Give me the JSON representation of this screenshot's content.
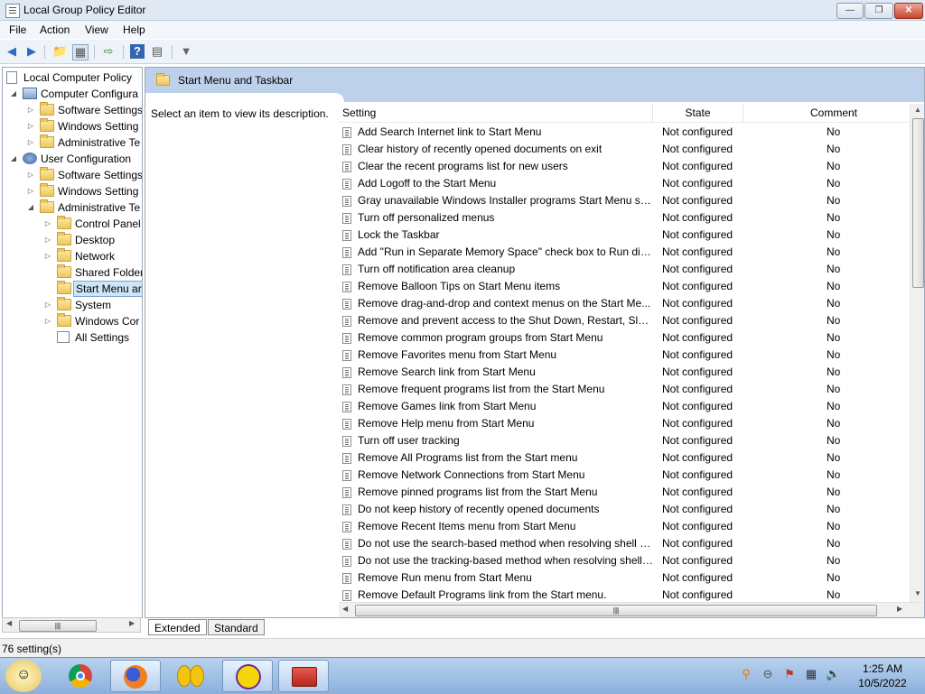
{
  "window": {
    "title": "Local Group Policy Editor"
  },
  "menubar": {
    "file": "File",
    "action": "Action",
    "view": "View",
    "help": "Help"
  },
  "tree": {
    "root": "Local Computer Policy",
    "computer_configuration": "Computer Configura",
    "cc_software_settings": "Software Settings",
    "cc_windows_settings": "Windows Setting",
    "cc_administrative_templates": "Administrative Te",
    "user_configuration": "User Configuration",
    "uc_software_settings": "Software Settings",
    "uc_windows_settings": "Windows Setting",
    "uc_administrative_templates": "Administrative Te",
    "control_panel": "Control Panel",
    "desktop": "Desktop",
    "network": "Network",
    "shared_folders": "Shared Folder",
    "start_menu": "Start Menu ar",
    "system": "System",
    "windows_components": "Windows Cor",
    "all_settings": "All Settings"
  },
  "details": {
    "header": "Start Menu and Taskbar",
    "description": "Select an item to view its description.",
    "columns": {
      "setting": "Setting",
      "state": "State",
      "comment": "Comment"
    },
    "rows": [
      {
        "setting": "Add Search Internet link to Start Menu",
        "state": "Not configured",
        "comment": "No"
      },
      {
        "setting": "Clear history of recently opened documents on exit",
        "state": "Not configured",
        "comment": "No"
      },
      {
        "setting": "Clear the recent programs list for new users",
        "state": "Not configured",
        "comment": "No"
      },
      {
        "setting": "Add Logoff to the Start Menu",
        "state": "Not configured",
        "comment": "No"
      },
      {
        "setting": "Gray unavailable Windows Installer programs Start Menu sh...",
        "state": "Not configured",
        "comment": "No"
      },
      {
        "setting": "Turn off personalized menus",
        "state": "Not configured",
        "comment": "No"
      },
      {
        "setting": "Lock the Taskbar",
        "state": "Not configured",
        "comment": "No"
      },
      {
        "setting": "Add \"Run in Separate Memory Space\" check box to Run dial...",
        "state": "Not configured",
        "comment": "No"
      },
      {
        "setting": "Turn off notification area cleanup",
        "state": "Not configured",
        "comment": "No"
      },
      {
        "setting": "Remove Balloon Tips on Start Menu items",
        "state": "Not configured",
        "comment": "No"
      },
      {
        "setting": "Remove drag-and-drop and context menus on the Start Me...",
        "state": "Not configured",
        "comment": "No"
      },
      {
        "setting": "Remove and prevent access to the Shut Down, Restart, Sleep...",
        "state": "Not configured",
        "comment": "No"
      },
      {
        "setting": "Remove common program groups from Start Menu",
        "state": "Not configured",
        "comment": "No"
      },
      {
        "setting": "Remove Favorites menu from Start Menu",
        "state": "Not configured",
        "comment": "No"
      },
      {
        "setting": "Remove Search link from Start Menu",
        "state": "Not configured",
        "comment": "No"
      },
      {
        "setting": "Remove frequent programs list from the Start Menu",
        "state": "Not configured",
        "comment": "No"
      },
      {
        "setting": "Remove Games link from Start Menu",
        "state": "Not configured",
        "comment": "No"
      },
      {
        "setting": "Remove Help menu from Start Menu",
        "state": "Not configured",
        "comment": "No"
      },
      {
        "setting": "Turn off user tracking",
        "state": "Not configured",
        "comment": "No"
      },
      {
        "setting": "Remove All Programs list from the Start menu",
        "state": "Not configured",
        "comment": "No"
      },
      {
        "setting": "Remove Network Connections from Start Menu",
        "state": "Not configured",
        "comment": "No"
      },
      {
        "setting": "Remove pinned programs list from the Start Menu",
        "state": "Not configured",
        "comment": "No"
      },
      {
        "setting": "Do not keep history of recently opened documents",
        "state": "Not configured",
        "comment": "No"
      },
      {
        "setting": "Remove Recent Items menu from Start Menu",
        "state": "Not configured",
        "comment": "No"
      },
      {
        "setting": "Do not use the search-based method when resolving shell s...",
        "state": "Not configured",
        "comment": "No"
      },
      {
        "setting": "Do not use the tracking-based method when resolving shell ...",
        "state": "Not configured",
        "comment": "No"
      },
      {
        "setting": "Remove Run menu from Start Menu",
        "state": "Not configured",
        "comment": "No"
      },
      {
        "setting": "Remove Default Programs link from the Start menu.",
        "state": "Not configured",
        "comment": "No"
      }
    ]
  },
  "tabs": {
    "extended": "Extended",
    "standard": "Standard"
  },
  "status": {
    "text": "76 setting(s)"
  },
  "clock": {
    "time": "1:25 AM",
    "date": "10/5/2022"
  }
}
